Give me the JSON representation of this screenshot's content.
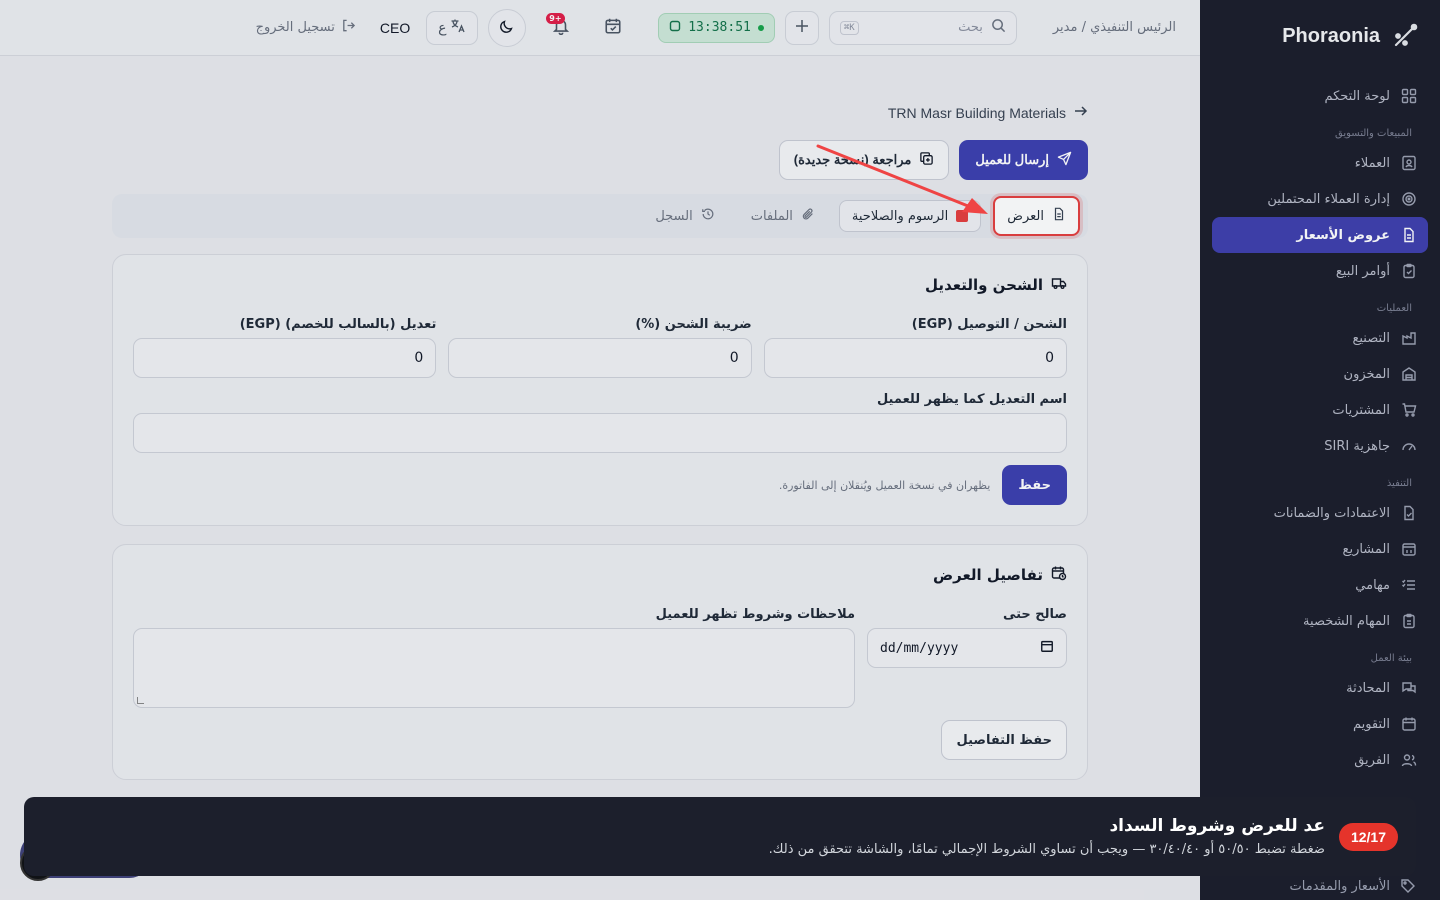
{
  "sidebar": {
    "brand": "Phoraonia",
    "groups": [
      {
        "title": "",
        "items": [
          {
            "label": "لوحة التحكم",
            "icon": "dashboard-icon"
          }
        ]
      },
      {
        "title": "المبيعات والتسويق",
        "items": [
          {
            "label": "العملاء",
            "icon": "contacts-icon"
          },
          {
            "label": "إدارة العملاء المحتملين",
            "icon": "target-icon"
          },
          {
            "label": "عروض الأسعار",
            "icon": "document-icon",
            "active": true
          },
          {
            "label": "أوامر البيع",
            "icon": "clipboard-icon"
          }
        ]
      },
      {
        "title": "العمليات",
        "items": [
          {
            "label": "التصنيع",
            "icon": "factory-icon"
          },
          {
            "label": "المخزون",
            "icon": "warehouse-icon"
          },
          {
            "label": "المشتريات",
            "icon": "cart-icon"
          },
          {
            "label": "جاهزية SIRI",
            "icon": "gauge-icon"
          }
        ]
      },
      {
        "title": "التنفيذ",
        "items": [
          {
            "label": "الاعتمادات والضمانات",
            "icon": "file-check-icon"
          },
          {
            "label": "المشاريع",
            "icon": "calendar-grid-icon"
          },
          {
            "label": "مهامي",
            "icon": "tasks-icon"
          },
          {
            "label": "المهام الشخصية",
            "icon": "clipboard-list-icon"
          }
        ]
      },
      {
        "title": "بيئة العمل",
        "items": [
          {
            "label": "المحادثة",
            "icon": "chat-icon"
          },
          {
            "label": "التقويم",
            "icon": "calendar-icon"
          },
          {
            "label": "الفريق",
            "icon": "users-icon"
          }
        ]
      }
    ],
    "last_item": "الأسعار والمقدمات"
  },
  "topbar": {
    "breadcrumb": "الرئيس التنفيذي / مدير",
    "search_placeholder": "بحث",
    "search_kbd": "K⌘",
    "clock": "13:38:51",
    "notifications_badge": "+9",
    "lang": "ع",
    "role": "CEO",
    "logout": "تسجيل الخروج"
  },
  "page": {
    "back_label": "TRN Masr Building Materials",
    "send_button": "إرسال للعميل",
    "review_button": "مراجعة (نسخة جديدة)",
    "tabs": [
      {
        "label": "العرض",
        "active": true
      },
      {
        "label": "الرسوم والصلاحية"
      },
      {
        "label": "الملفات"
      },
      {
        "label": "السجل"
      }
    ]
  },
  "shipping_card": {
    "title": "الشحن والتعديل",
    "fields": [
      {
        "label": "الشحن / التوصيل (EGP)",
        "value": "0"
      },
      {
        "label": "ضريبة الشحن (%)",
        "value": "0"
      },
      {
        "label": "تعديل (بالسالب للخصم) (EGP)",
        "value": "0"
      }
    ],
    "adjustment_name_label": "اسم التعديل كما يظهر للعميل",
    "adjustment_name_value": "",
    "save_button": "حفظ",
    "hint": "يظهران في نسخة العميل ويُنقلان إلى الفاتورة."
  },
  "details_card": {
    "title": "تفاصيل العرض",
    "valid_until_label": "صالح حتى",
    "valid_until_placeholder": "dd/mm/yyyy",
    "notes_label": "ملاحظات وشروط تظهر للعميل",
    "notes_value": "",
    "save_button": "حفظ التفاصيل"
  },
  "tour": {
    "step": "12/17",
    "title": "عد للعرض وشروط السداد",
    "description": "ضغطة تضبط ٥٠/٥٠ أو ٣٠/٤٠/٤٠ — ويجب أن تساوي الشروط الإجمالي تمامًا، والشاشة تتحقق من ذلك."
  },
  "colors": {
    "primary": "#3c3fb0",
    "sidebar_bg": "#1b1d2b",
    "highlight": "#e53e3e",
    "clock_green": "#13734a"
  }
}
